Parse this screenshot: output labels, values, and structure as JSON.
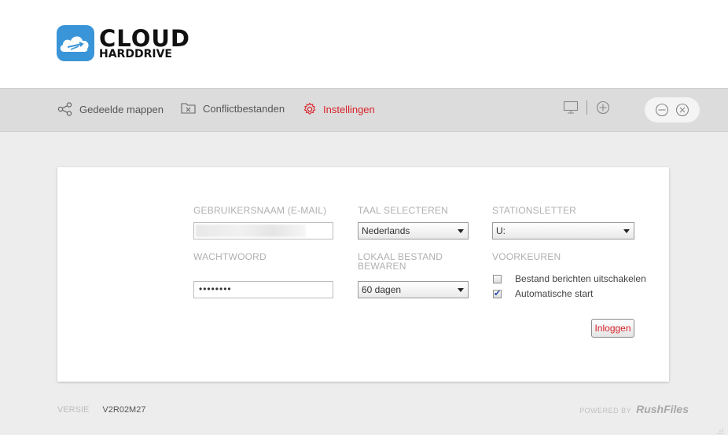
{
  "brand": {
    "line1": "CLOUD",
    "line2": "HARDDRIVE",
    "accent": "#3a95d8"
  },
  "nav": {
    "items": [
      {
        "label": "Gedeelde mappen",
        "icon": "share-icon"
      },
      {
        "label": "Conflictbestanden",
        "icon": "conflict-icon"
      },
      {
        "label": "Instellingen",
        "icon": "gear-icon",
        "active": true
      }
    ],
    "active_color": "#d8232a",
    "right_icons": [
      "monitor-icon",
      "plus-circle-icon",
      "minimize-icon",
      "close-icon"
    ]
  },
  "form": {
    "username_label": "GEBRUIKERSNAAM (E-MAIL)",
    "username_value": "",
    "password_label": "WACHTWOORD",
    "password_value": "••••••••",
    "language_label": "TAAL SELECTEREN",
    "language_value": "Nederlands",
    "keep_label": "LOKAAL BESTAND BEWAREN",
    "keep_value": "60 dagen",
    "drive_label": "STATIONSLETTER",
    "drive_value": "U:",
    "prefs_label": "VOORKEUREN",
    "prefs": [
      {
        "label": "Bestand berichten uitschakelen",
        "checked": false
      },
      {
        "label": "Automatische start",
        "checked": true
      }
    ],
    "login_label": "Inloggen"
  },
  "footer": {
    "version_label": "VERSIE",
    "version_value": "V2R02M27",
    "powered_by": "POWERED BY",
    "powered_brand": "RushFiles"
  }
}
